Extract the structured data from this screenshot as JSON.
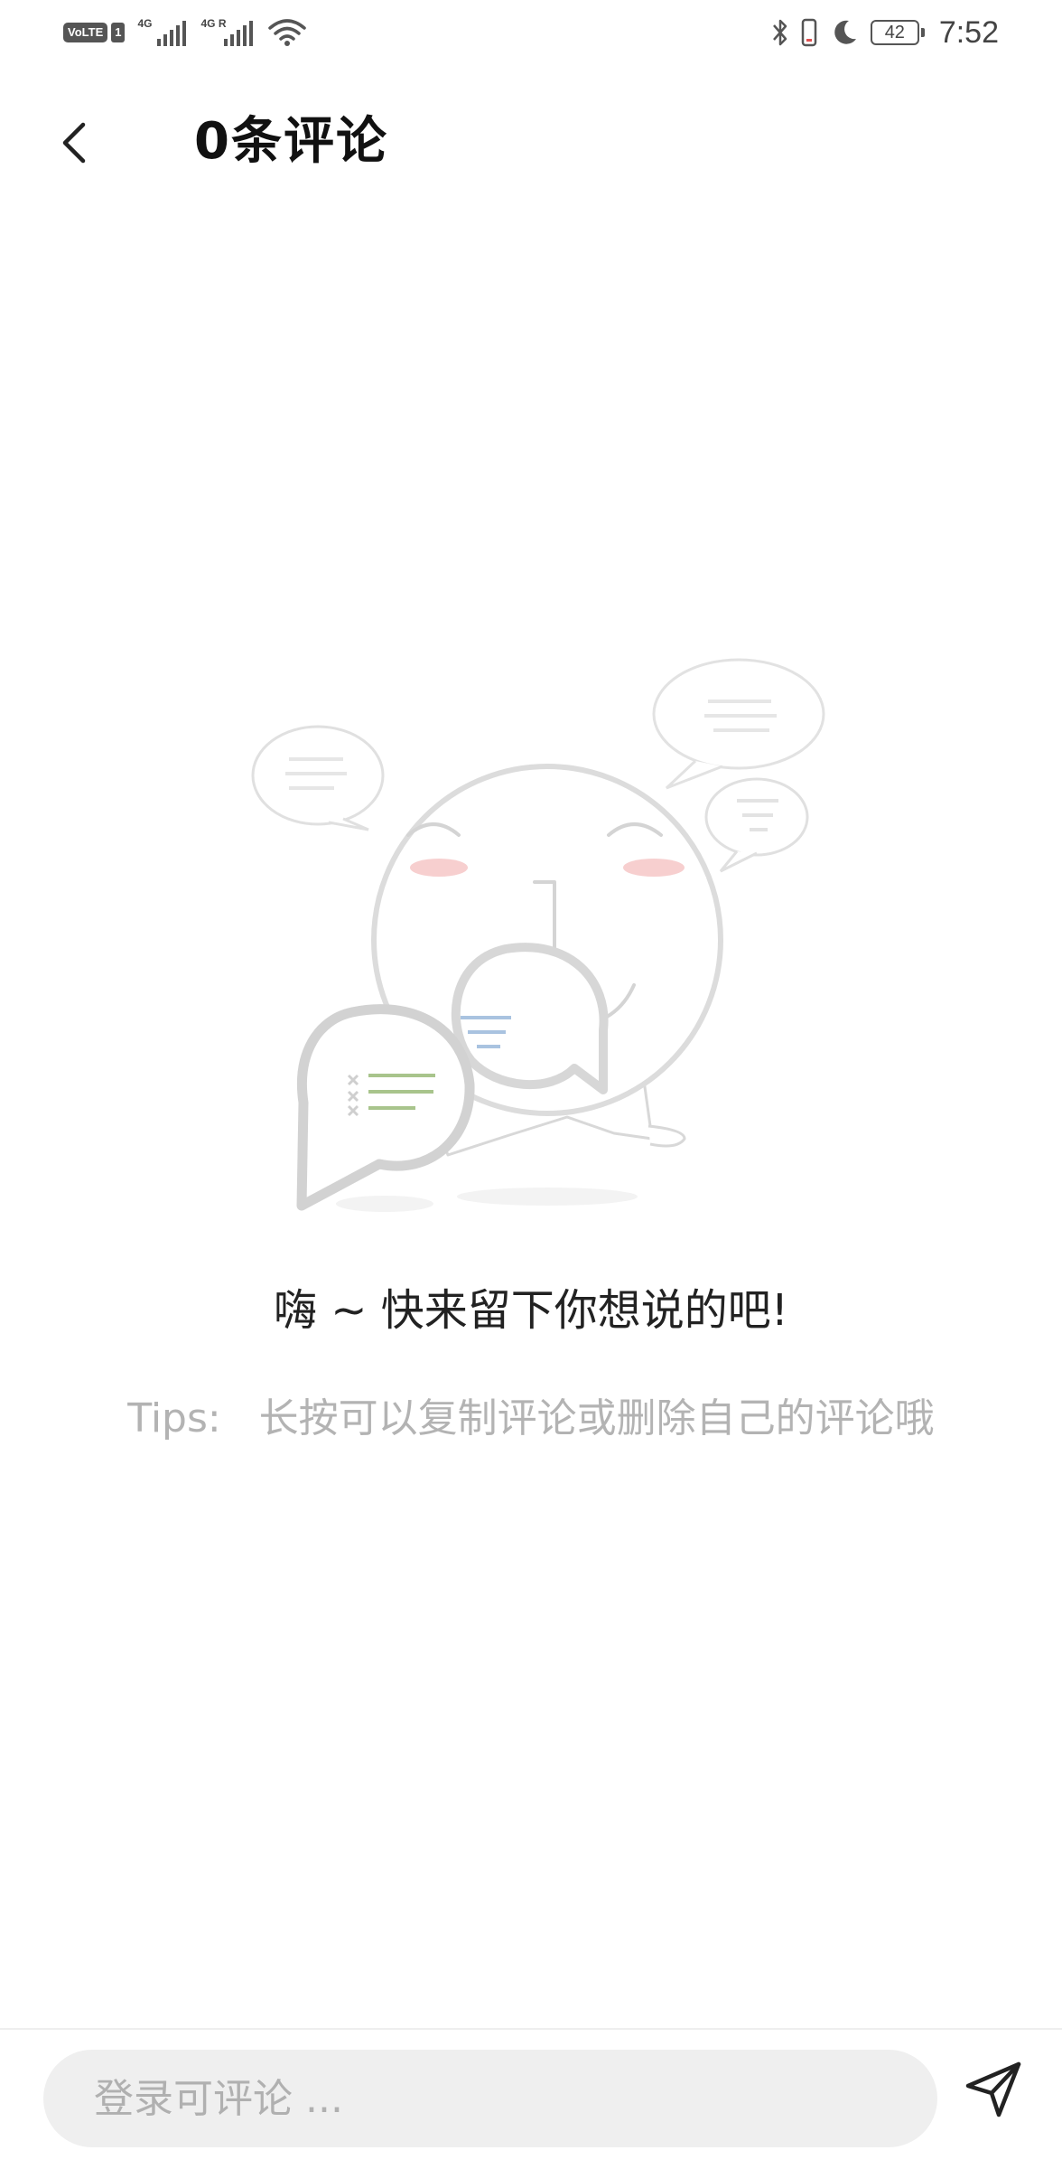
{
  "status_bar": {
    "volte_label": "VoLTE",
    "sim_label": "1",
    "sim1_network": "4G",
    "sim2_network": "4G R",
    "battery_level": "42",
    "time": "7:52",
    "icons": [
      "volte-icon",
      "signal-icon",
      "signal-icon",
      "wifi-icon",
      "bluetooth-icon",
      "vibrate-icon",
      "moon-icon",
      "battery-icon"
    ]
  },
  "header": {
    "title": "0条评论",
    "back_icon": "back-chevron-icon"
  },
  "empty_state": {
    "illustration": "smiling-face-with-speech-bubbles",
    "message": "嗨 ~ 快来留下你想说的吧!",
    "tips": "Tips:   长按可以复制评论或删除自己的评论哦"
  },
  "comment_bar": {
    "placeholder": "登录可评论 ...",
    "value": "",
    "send_icon": "send-icon"
  },
  "colors": {
    "title_text": "#111111",
    "tips_text": "#b3b3b3",
    "input_background": "#efefef",
    "illustration_line": "#d9d9d9",
    "cheek_pink": "#f7cfcf",
    "bubble_green": "#a8c48c",
    "bubble_blue": "#a9c3e0"
  }
}
